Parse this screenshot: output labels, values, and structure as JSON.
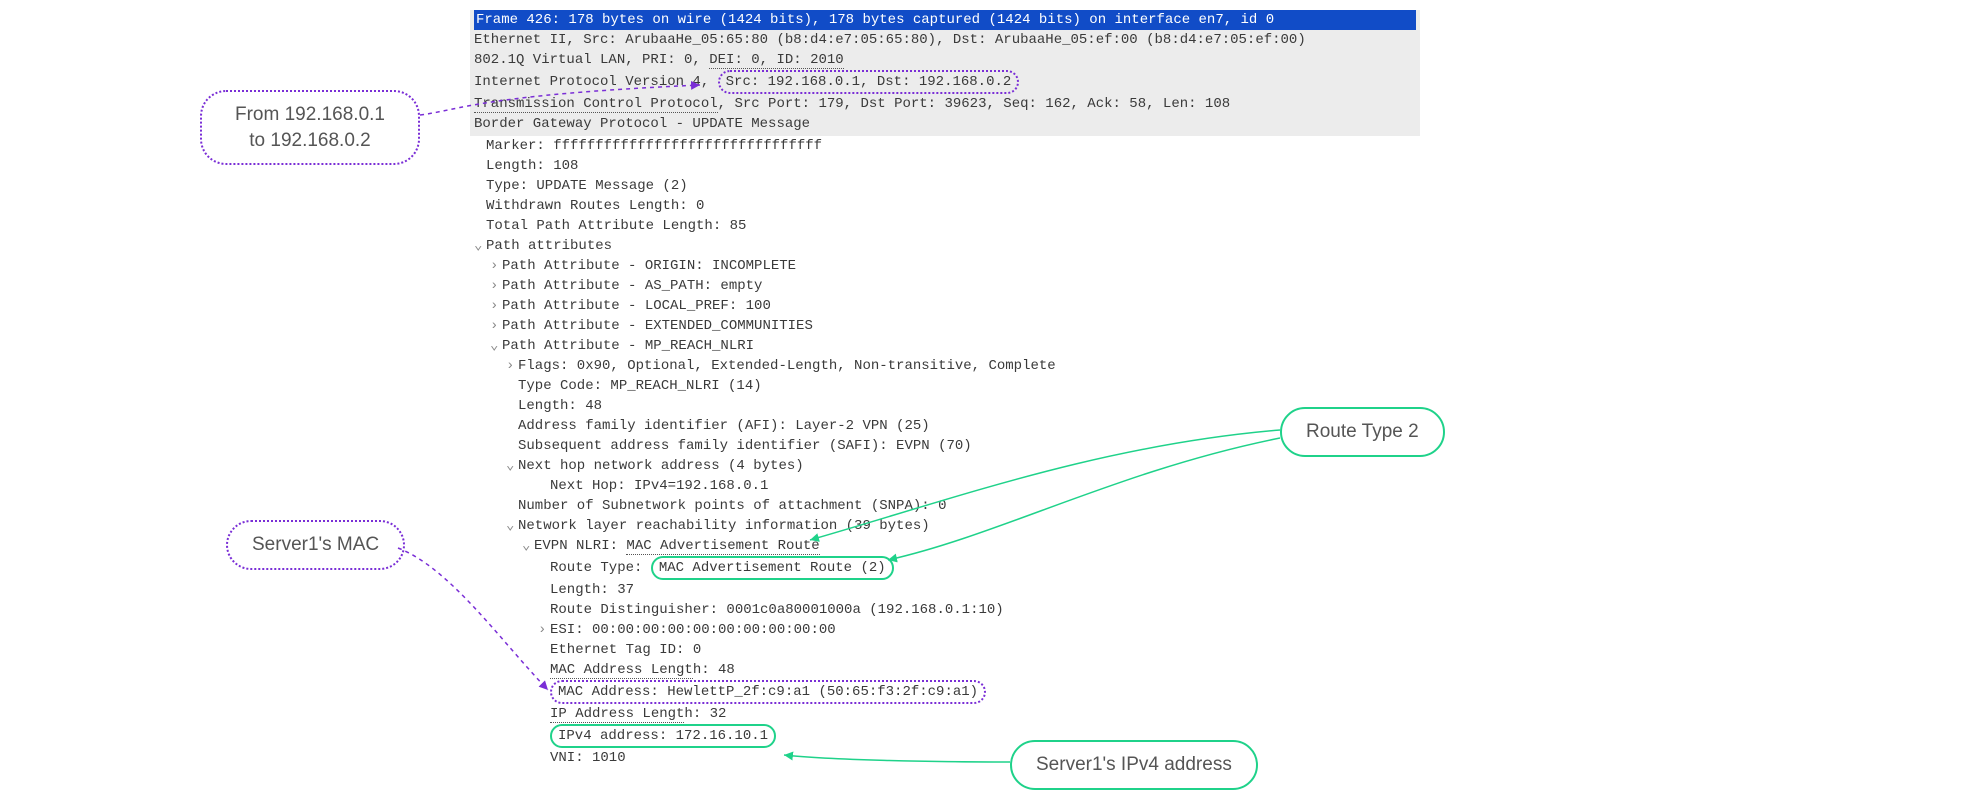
{
  "packet": {
    "frame": "Frame 426: 178 bytes on wire (1424 bits), 178 bytes captured (1424 bits) on interface en7, id 0",
    "eth": "Ethernet II, Src: ArubaaHe_05:65:80 (b8:d4:e7:05:65:80), Dst: ArubaaHe_05:ef:00 (b8:d4:e7:05:ef:00)",
    "vlan_pre": "802.1Q Virtual LAN, PRI: 0, ",
    "vlan_dei": "DEI: 0, ID: 2010",
    "ip_pre": "Internet Protocol Version 4, ",
    "ip_srcdst": "Src: 192.168.0.1, Dst: 192.168.0.2",
    "tcp_pre": "Transmission Control Protocol",
    "tcp_rest": ", Src Port: 179, Dst Port: 39623, Seq: 162, Ack: 58, Len: 108",
    "bgp": "Border Gateway Protocol - UPDATE Message",
    "marker": "Marker: ffffffffffffffffffffffffffffffff",
    "length": "Length: 108",
    "type": "Type: UPDATE Message (2)",
    "withdrawn": "Withdrawn Routes Length: 0",
    "tpal": "Total Path Attribute Length: 85",
    "pathattr": "Path attributes",
    "pa_origin": "Path Attribute - ORIGIN: INCOMPLETE",
    "pa_aspath": "Path Attribute - AS_PATH: empty",
    "pa_localpref": "Path Attribute - LOCAL_PREF: 100",
    "pa_extcomm": "Path Attribute - EXTENDED_COMMUNITIES",
    "pa_mpreach": "Path Attribute - MP_REACH_NLRI",
    "flags": "Flags: 0x90, Optional, Extended-Length, Non-transitive, Complete",
    "typecode": "Type Code: MP_REACH_NLRI (14)",
    "len48": "Length: 48",
    "afi": "Address family identifier (AFI): Layer-2 VPN (25)",
    "safi": "Subsequent address family identifier (SAFI): EVPN (70)",
    "nhna": "Next hop network address (4 bytes)",
    "nexthop": "Next Hop: IPv4=192.168.0.1",
    "snpa": "Number of Subnetwork points of attachment (SNPA): 0",
    "nlri": "Network layer reachability information (39 bytes)",
    "evpn_pre": "EVPN NLRI: ",
    "evpn_rt": "MAC Advertisement Route",
    "rt_pre": "Route Type: ",
    "rt_val": "MAC Advertisement Route (2)",
    "len37": "Length: 37",
    "rd": "Route Distinguisher: 0001c0a80001000a (192.168.0.1:10)",
    "esi": "ESI: 00:00:00:00:00:00:00:00:00:00",
    "etag": "Ethernet Tag ID: 0",
    "macal_pre": "MAC Address Lengt",
    "macal_suf": "h: 48",
    "mac": "MAC Address: HewlettP_2f:c9:a1 (50:65:f3:2f:c9:a1)",
    "ipal_pre": "IP Address Lengt",
    "ipal_suf": "h: 32",
    "ipv4": "IPv4 address: 172.16.10.1",
    "vni": "VNI: 1010"
  },
  "callouts": {
    "from_to_1": "From 192.168.0.1",
    "from_to_2": "to 192.168.0.2",
    "server1_mac": "Server1's MAC",
    "route_type_2": "Route Type 2",
    "server1_ipv4": "Server1's IPv4 address"
  }
}
